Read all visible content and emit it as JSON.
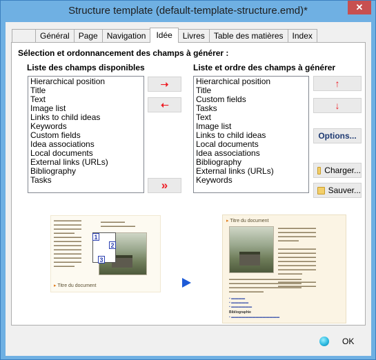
{
  "window": {
    "title": "Structure template (default-template-structure.emd)*",
    "close_label": "✕"
  },
  "tabs": [
    {
      "label": ""
    },
    {
      "label": "Général"
    },
    {
      "label": "Page"
    },
    {
      "label": "Navigation"
    },
    {
      "label": "Idée",
      "active": true
    },
    {
      "label": "Livres"
    },
    {
      "label": "Table des matières"
    },
    {
      "label": "Index"
    }
  ],
  "panel": {
    "heading": "Sélection et ordonnancement des champs à générer :",
    "available_title": "Liste des champs disponibles",
    "selected_title": "Liste et ordre des champs à générer",
    "available_fields": [
      "Hierarchical position",
      "Title",
      "Text",
      "Image list",
      "Links to child ideas",
      "Keywords",
      "Custom fields",
      "Idea associations",
      "Local documents",
      "External links (URLs)",
      "Bibliography",
      "Tasks"
    ],
    "selected_fields": [
      "Hierarchical position",
      "Title",
      "Custom fields",
      "Tasks",
      "Text",
      "Image list",
      "Links to child ideas",
      "Local documents",
      "Idea associations",
      "Bibliography",
      "External links (URLs)",
      "Keywords"
    ]
  },
  "buttons": {
    "add": "➝",
    "remove": "➝",
    "add_all": "»",
    "move_up": "↑",
    "move_down": "↓",
    "options": "Options...",
    "load": "Charger...",
    "save": "Sauver..."
  },
  "preview": {
    "left_link": "Titre du document",
    "right_title": "Titre du document",
    "bibliography_label": "Bibliographie",
    "badges": [
      "1",
      "2",
      "3"
    ]
  },
  "footer": {
    "ok_label": "OK"
  }
}
